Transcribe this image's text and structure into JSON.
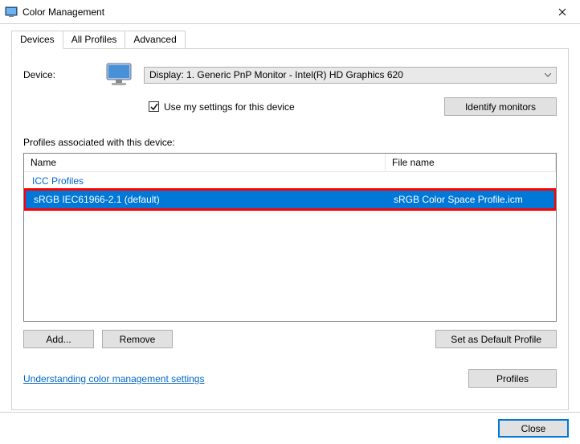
{
  "window": {
    "title": "Color Management"
  },
  "tabs": {
    "devices": "Devices",
    "allProfiles": "All Profiles",
    "advanced": "Advanced"
  },
  "device": {
    "label": "Device:",
    "selected": "Display: 1. Generic PnP Monitor - Intel(R) HD Graphics 620",
    "useSettingsLabel": "Use my settings for this device",
    "identifyLabel": "Identify monitors"
  },
  "profiles": {
    "sectionLabel": "Profiles associated with this device:",
    "columns": {
      "name": "Name",
      "file": "File name"
    },
    "groupLabel": "ICC Profiles",
    "rows": [
      {
        "name": "sRGB IEC61966-2.1 (default)",
        "file": "sRGB Color Space Profile.icm"
      }
    ]
  },
  "buttons": {
    "add": "Add...",
    "remove": "Remove",
    "setDefault": "Set as Default Profile",
    "profiles": "Profiles",
    "close": "Close"
  },
  "link": {
    "understand": "Understanding color management settings"
  }
}
